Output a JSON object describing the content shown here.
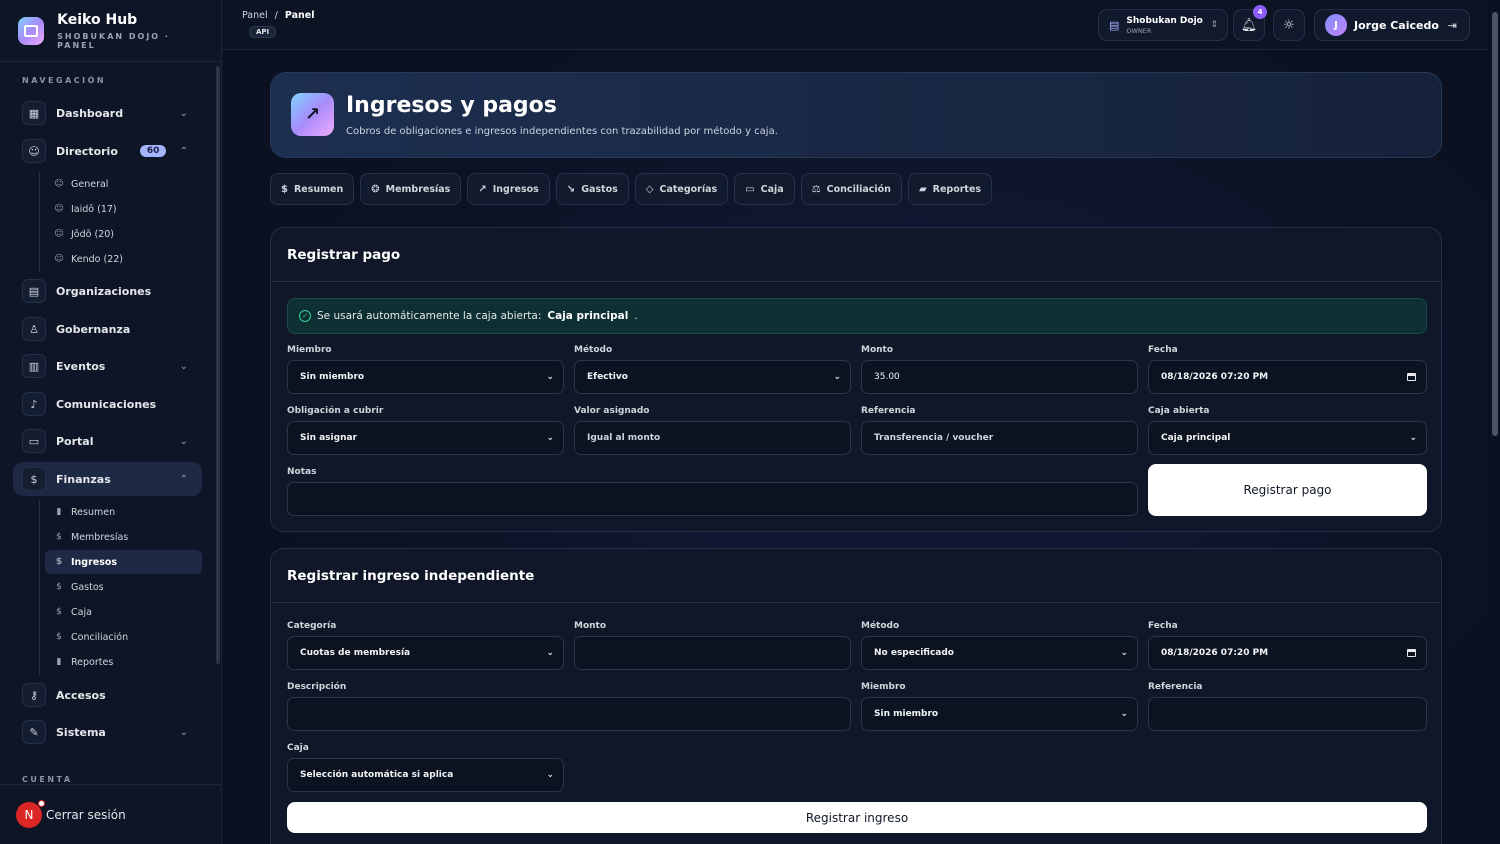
{
  "brand": {
    "name": "Keiko Hub",
    "subtitle": "SHOBUKAN DOJO · PANEL"
  },
  "sidebar": {
    "nav_label": "NAVEGACIÓN",
    "account_label": "CUENTA",
    "items": [
      {
        "label": "Dashboard",
        "icon": "grid-icon"
      },
      {
        "label": "Directorio",
        "icon": "users-icon",
        "badge": "60"
      },
      {
        "label": "Organizaciones",
        "icon": "building-icon"
      },
      {
        "label": "Gobernanza",
        "icon": "hierarchy-icon"
      },
      {
        "label": "Eventos",
        "icon": "calendar-icon"
      },
      {
        "label": "Comunicaciones",
        "icon": "bell-icon"
      },
      {
        "label": "Portal",
        "icon": "id-card-icon"
      },
      {
        "label": "Finanzas",
        "icon": "dollar-icon"
      },
      {
        "label": "Accesos",
        "icon": "key-icon"
      },
      {
        "label": "Sistema",
        "icon": "wrench-icon"
      }
    ],
    "directorio_sub": [
      "General",
      "Iaidō (17)",
      "Jōdō (20)",
      "Kendo (22)"
    ],
    "finanzas_sub": [
      "Resumen",
      "Membresías",
      "Ingresos",
      "Gastos",
      "Caja",
      "Conciliación",
      "Reportes"
    ],
    "footer": {
      "avatar_letter": "N",
      "logout": "Cerrar sesión"
    }
  },
  "topbar": {
    "breadcrumb_root": "Panel",
    "breadcrumb_sep": "/",
    "breadcrumb_current": "Panel",
    "api_badge": "API",
    "org": {
      "name": "Shobukan Dojo",
      "role": "OWNER"
    },
    "notifications": "4",
    "user": {
      "initial": "J",
      "name": "Jorge Caicedo"
    }
  },
  "hero": {
    "title": "Ingresos y pagos",
    "subtitle": "Cobros de obligaciones e ingresos independientes con trazabilidad por método y caja."
  },
  "tabs": [
    "Resumen",
    "Membresías",
    "Ingresos",
    "Gastos",
    "Categorías",
    "Caja",
    "Conciliación",
    "Reportes"
  ],
  "pago": {
    "title": "Registrar pago",
    "alert_text": "Se usará automáticamente la caja abierta:",
    "alert_caja": "Caja principal",
    "alert_end": ".",
    "labels": {
      "miembro": "Miembro",
      "metodo": "Método",
      "monto": "Monto",
      "fecha": "Fecha",
      "obligacion": "Obligación a cubrir",
      "valor": "Valor asignado",
      "referencia": "Referencia",
      "caja": "Caja abierta",
      "notas": "Notas"
    },
    "values": {
      "miembro": "Sin miembro",
      "metodo": "Efectivo",
      "monto": "35.00",
      "fecha": "08/18/2026 07:20 PM",
      "obligacion": "Sin asignar",
      "caja": "Caja principal"
    },
    "placeholders": {
      "valor": "Igual al monto",
      "referencia": "Transferencia / voucher"
    },
    "submit": "Registrar pago"
  },
  "ingreso": {
    "title": "Registrar ingreso independiente",
    "labels": {
      "categoria": "Categoría",
      "monto": "Monto",
      "metodo": "Método",
      "fecha": "Fecha",
      "descripcion": "Descripción",
      "miembro": "Miembro",
      "referencia": "Referencia",
      "caja": "Caja"
    },
    "values": {
      "categoria": "Cuotas de membresía",
      "metodo": "No especificado",
      "fecha": "08/18/2026 07:20 PM",
      "miembro": "Sin miembro",
      "caja": "Selección automática si aplica"
    },
    "submit": "Registrar ingreso"
  }
}
